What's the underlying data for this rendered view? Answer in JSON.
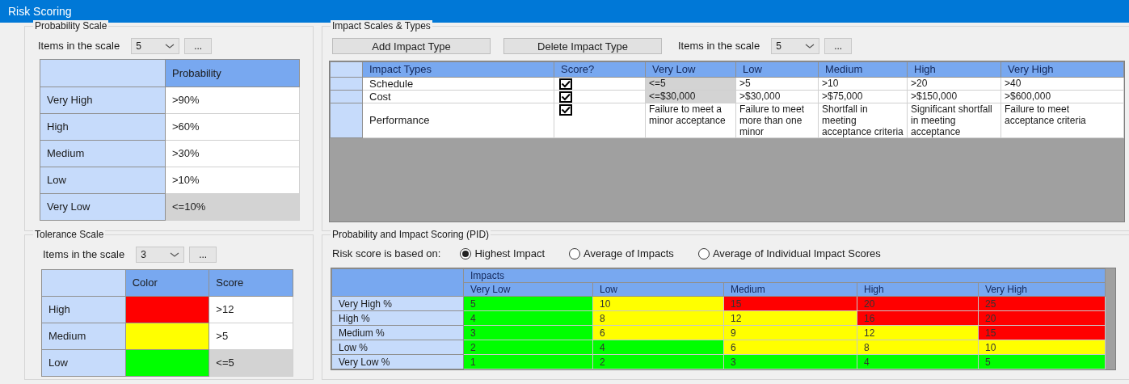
{
  "window": {
    "title": "Risk Scoring"
  },
  "probability_scale": {
    "title": "Probability Scale",
    "items_label": "Items in the scale",
    "items_value": "5",
    "more_button": "...",
    "header": "Probability",
    "rows": [
      {
        "label": "Very High",
        "value": ">90%",
        "greyed": false
      },
      {
        "label": "High",
        "value": ">60%",
        "greyed": false
      },
      {
        "label": "Medium",
        "value": ">30%",
        "greyed": false
      },
      {
        "label": "Low",
        "value": ">10%",
        "greyed": false
      },
      {
        "label": "Very Low",
        "value": "<=10%",
        "greyed": true
      }
    ]
  },
  "tolerance_scale": {
    "title": "Tolerance Scale",
    "items_label": "Items in the scale",
    "items_value": "3",
    "more_button": "...",
    "columns": [
      "Color",
      "Score"
    ],
    "rows": [
      {
        "label": "High",
        "color": "#ff0000",
        "score": ">12",
        "greyed": false
      },
      {
        "label": "Medium",
        "color": "#ffff00",
        "score": ">5",
        "greyed": false
      },
      {
        "label": "Low",
        "color": "#00ff00",
        "score": "<=5",
        "greyed": true
      }
    ]
  },
  "impact_scales": {
    "title": "Impact Scales & Types",
    "buttons": [
      "Add Impact Type",
      "Delete Impact Type"
    ],
    "items_label": "Items in the scale",
    "items_value": "5",
    "more_button": "...",
    "columns": [
      "Impact Types",
      "Score?",
      "Very Low",
      "Low",
      "Medium",
      "High",
      "Very High"
    ],
    "rows": [
      {
        "cells": [
          {
            "kind": "name",
            "text": "Schedule"
          },
          {
            "kind": "checkbox",
            "checked": true
          },
          {
            "kind": "text",
            "text": "<=5",
            "greyed": true
          },
          {
            "text": ">5",
            "greyed": false
          },
          {
            "text": ">10",
            "greyed": false
          },
          {
            "text": ">20",
            "greyed": false
          },
          {
            "text": ">40",
            "greyed": false
          }
        ]
      },
      {
        "cells": [
          {
            "kind": "name",
            "text": "Cost"
          },
          {
            "kind": "checkbox",
            "checked": true
          },
          {
            "kind": "text",
            "text": "<=$30,000",
            "greyed": true
          },
          {
            "text": ">$30,000",
            "greyed": false
          },
          {
            "text": ">$75,000",
            "greyed": false
          },
          {
            "text": ">$150,000",
            "greyed": false
          },
          {
            "text": ">$600,000",
            "greyed": false
          }
        ]
      },
      {
        "cells": [
          {
            "kind": "name",
            "text": "Performance"
          },
          {
            "kind": "checkbox",
            "checked": true
          },
          {
            "kind": "text",
            "text": "Failure to meet a minor acceptance",
            "greyed": false
          },
          {
            "text": "Failure to meet more than one minor",
            "greyed": false
          },
          {
            "text": "Shortfall in meeting acceptance criteria",
            "greyed": false
          },
          {
            "text": "Significant shortfall in meeting acceptance",
            "greyed": false
          },
          {
            "text": "Failure to meet acceptance criteria",
            "greyed": false
          }
        ]
      }
    ]
  },
  "pid": {
    "title": "Probability and Impact Scoring (PID)",
    "based_on_label": "Risk score is based on:",
    "options": [
      {
        "label": "Highest Impact",
        "selected": true
      },
      {
        "label": "Average of Impacts",
        "selected": false
      },
      {
        "label": "Average of Individual Impact Scores",
        "selected": false
      }
    ],
    "impacts_header": "Impacts",
    "columns": [
      "Very Low",
      "Low",
      "Medium",
      "High",
      "Very High"
    ],
    "rows": [
      {
        "label": "Very High %",
        "cells": [
          {
            "value": "5",
            "color": "#00ff00"
          },
          {
            "value": "10",
            "color": "#ffff00"
          },
          {
            "value": "15",
            "color": "#ff0000"
          },
          {
            "value": "20",
            "color": "#ff0000"
          },
          {
            "value": "25",
            "color": "#ff0000"
          }
        ]
      },
      {
        "label": "High %",
        "cells": [
          {
            "value": "4",
            "color": "#00ff00"
          },
          {
            "value": "8",
            "color": "#ffff00"
          },
          {
            "value": "12",
            "color": "#ffff00"
          },
          {
            "value": "16",
            "color": "#ff0000"
          },
          {
            "value": "20",
            "color": "#ff0000"
          }
        ]
      },
      {
        "label": "Medium %",
        "cells": [
          {
            "value": "3",
            "color": "#00ff00"
          },
          {
            "value": "6",
            "color": "#ffff00"
          },
          {
            "value": "9",
            "color": "#ffff00"
          },
          {
            "value": "12",
            "color": "#ffff00"
          },
          {
            "value": "15",
            "color": "#ff0000"
          }
        ]
      },
      {
        "label": "Low %",
        "cells": [
          {
            "value": "2",
            "color": "#00ff00"
          },
          {
            "value": "4",
            "color": "#00ff00"
          },
          {
            "value": "6",
            "color": "#ffff00"
          },
          {
            "value": "8",
            "color": "#ffff00"
          },
          {
            "value": "10",
            "color": "#ffff00"
          }
        ]
      },
      {
        "label": "Very Low %",
        "cells": [
          {
            "value": "1",
            "color": "#00ff00"
          },
          {
            "value": "2",
            "color": "#00ff00"
          },
          {
            "value": "3",
            "color": "#00ff00"
          },
          {
            "value": "4",
            "color": "#00ff00"
          },
          {
            "value": "5",
            "color": "#00ff00"
          }
        ]
      }
    ]
  }
}
